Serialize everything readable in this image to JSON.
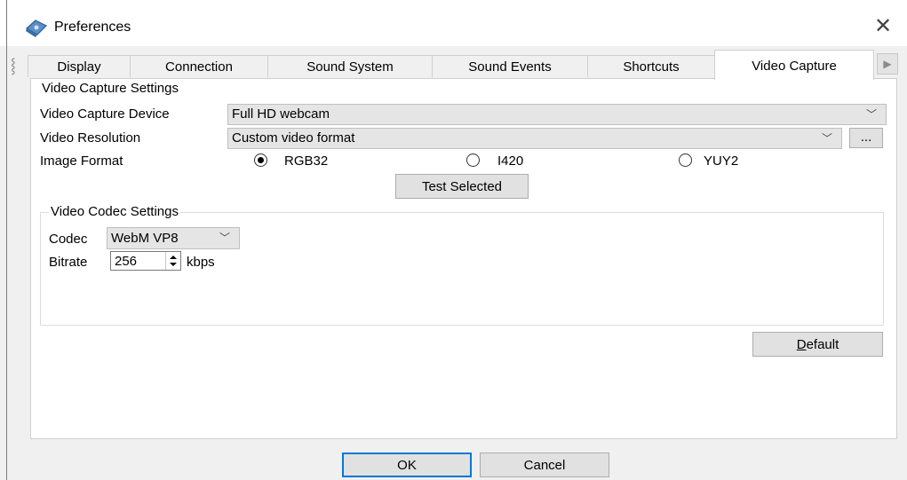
{
  "window": {
    "title": "Preferences",
    "close_glyph": "✕"
  },
  "tabs": [
    {
      "label": "Display",
      "active": false
    },
    {
      "label": "Connection",
      "active": false
    },
    {
      "label": "Sound System",
      "active": false
    },
    {
      "label": "Sound Events",
      "active": false
    },
    {
      "label": "Shortcuts",
      "active": false
    },
    {
      "label": "Video Capture",
      "active": true
    }
  ],
  "tab_scroll_glyph": "▶",
  "video_capture": {
    "group_title": "Video Capture Settings",
    "device_label": "Video Capture Device",
    "device_value": "Full HD webcam",
    "resolution_label": "Video Resolution",
    "resolution_value": "Custom video format",
    "resolution_more_button": "...",
    "image_format_label": "Image Format",
    "image_formats": [
      {
        "label": "RGB32",
        "selected": true
      },
      {
        "label": "I420",
        "selected": false
      },
      {
        "label": "YUY2",
        "selected": false
      }
    ],
    "test_button": "Test Selected"
  },
  "codec": {
    "group_title": "Video Codec Settings",
    "codec_label": "Codec",
    "codec_value": "WebM VP8",
    "bitrate_label": "Bitrate",
    "bitrate_value": "256",
    "bitrate_unit": "kbps"
  },
  "default_button": {
    "mnemonic": "D",
    "rest": "efault"
  },
  "footer": {
    "ok": "OK",
    "cancel": "Cancel"
  },
  "colors": {
    "panel_bg": "#ffffff",
    "window_bg": "#f0f0f0",
    "ok_border": "#0078d7"
  }
}
